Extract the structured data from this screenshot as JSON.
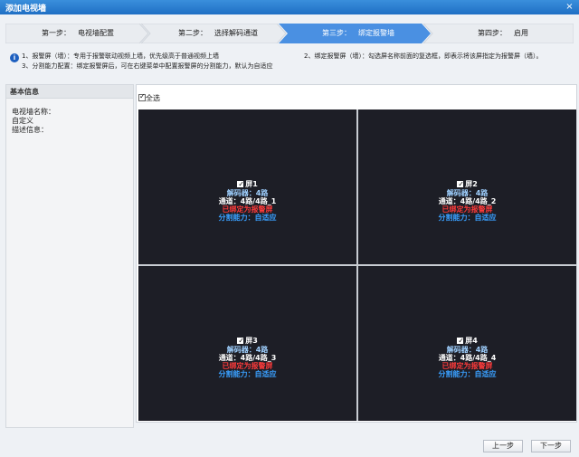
{
  "window": {
    "title": "添加电视墙",
    "close_glyph": "×"
  },
  "steps": [
    {
      "label": "第一步：",
      "name": "电视墙配置",
      "active": false
    },
    {
      "label": "第二步：",
      "name": "选择解码通道",
      "active": false
    },
    {
      "label": "第三步：",
      "name": "绑定报警墙",
      "active": true
    },
    {
      "label": "第四步：",
      "name": "启用",
      "active": false
    }
  ],
  "notes": {
    "line1a": "1、报警屏（墙）：专用于报警联动视频上墙，优先级高于普通视频上墙",
    "line1b": "2、绑定报警屏（墙）：勾选屏名称前面的复选框，即表示将该屏指定为报警屏（墙）。",
    "line2": "3、分割能力配置：绑定报警屏后，可在右键菜单中配置报警屏的分割能力，默认为自适应"
  },
  "sidebar": {
    "header": "基本信息",
    "name_label": "电视墙名称：",
    "name_value": "自定义",
    "desc_label": "描述信息："
  },
  "select_all_label": "全选",
  "screens": [
    {
      "name": "屏1",
      "decoder": "解码器：4路",
      "channel": "通道：4路/4路_1",
      "bound": "已绑定为报警屏",
      "split": "分割能力：自适应"
    },
    {
      "name": "屏2",
      "decoder": "解码器：4路",
      "channel": "通道：4路/4路_2",
      "bound": "已绑定为报警屏",
      "split": "分割能力：自适应"
    },
    {
      "name": "屏3",
      "decoder": "解码器：4路",
      "channel": "通道：4路/4路_3",
      "bound": "已绑定为报警屏",
      "split": "分割能力：自适应"
    },
    {
      "name": "屏4",
      "decoder": "解码器：4路",
      "channel": "通道：4路/4路_4",
      "bound": "已绑定为报警屏",
      "split": "分割能力：自适应"
    }
  ],
  "buttons": {
    "prev": "上一步",
    "next": "下一步"
  },
  "colors": {
    "titlebar": "#1f6fc4",
    "active_step": "#4a90e2",
    "screen_bg": "#1d1e26",
    "bound_text": "#ff3b3b",
    "split_text": "#3aa0ff"
  }
}
